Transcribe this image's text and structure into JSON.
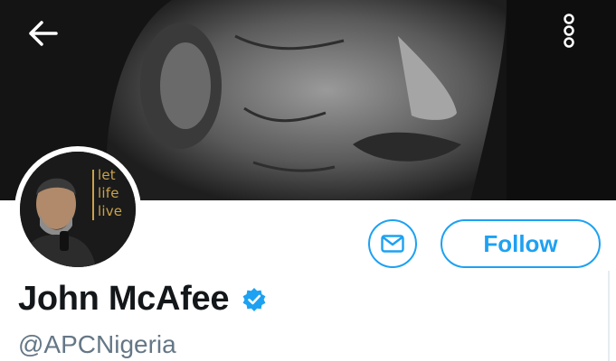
{
  "header": {
    "back_icon": "arrow-left-icon",
    "more_icon": "vertical-dots-icon",
    "banner_description_icon": "banner-photo"
  },
  "profile": {
    "avatar_text_lines": [
      "let",
      "life",
      "live"
    ],
    "display_name": "John McAfee",
    "verified_icon": "verified-badge-icon",
    "handle": "@APCNigeria"
  },
  "actions": {
    "message_icon": "envelope-icon",
    "follow_label": "Follow"
  },
  "colors": {
    "accent": "#1da1f2",
    "name_text": "#14171a",
    "handle_text": "#657786",
    "avatar_caption": "#c9a24a"
  }
}
